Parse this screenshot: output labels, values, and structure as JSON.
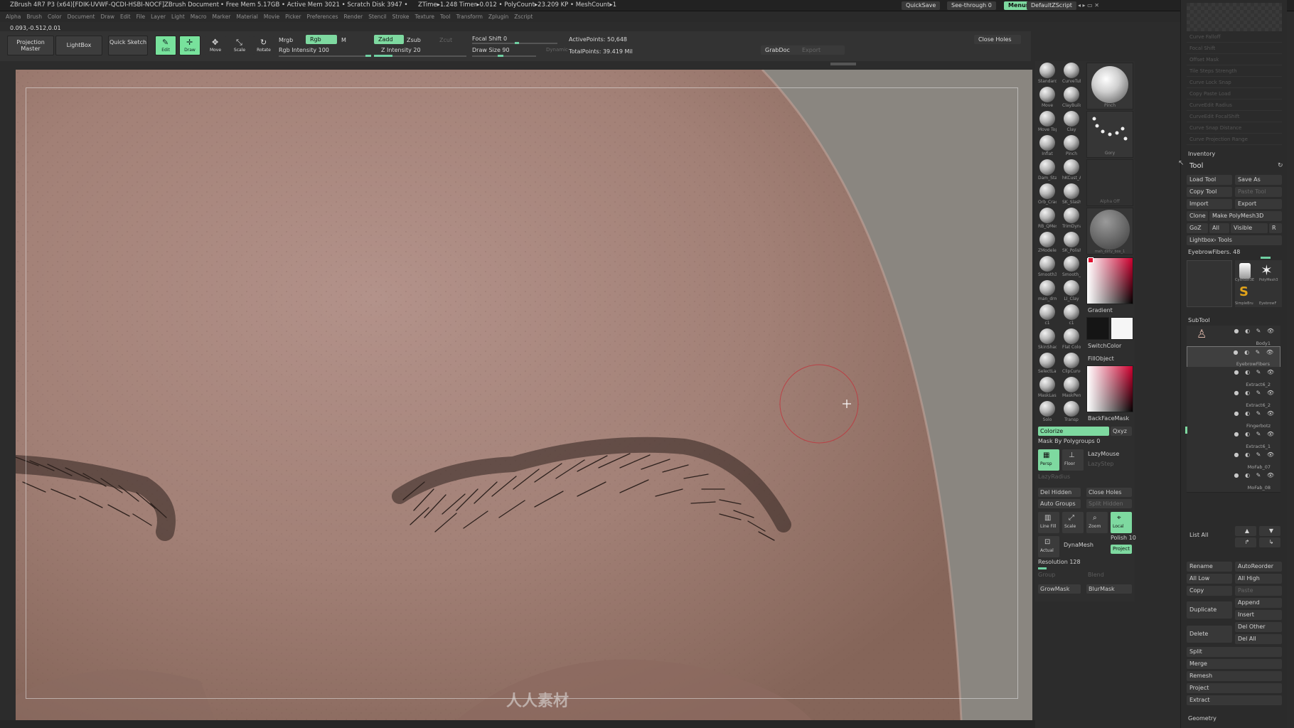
{
  "app": {
    "title": "ZBrush 4R7 P3 (x64)[FDIK-UVWF-QCDI-HSBI-NOCF]ZBrush Document",
    "mem": "• Free Mem 5.17GB • Active Mem 3021 • Scratch Disk 3947 •",
    "timer": "ZTime▸1.248 Timer▸0.012 • PolyCount▸23.209 KP • MeshCount▸1",
    "quicksave": "QuickSave",
    "see_through": "See-through   0",
    "menus": "Menus",
    "default_script": "DefaultZScript"
  },
  "menubar": [
    "Alpha",
    "Brush",
    "Color",
    "Document",
    "Draw",
    "Edit",
    "File",
    "Layer",
    "Light",
    "Macro",
    "Marker",
    "Material",
    "Movie",
    "Picker",
    "Preferences",
    "Render",
    "Stencil",
    "Stroke",
    "Texture",
    "Tool",
    "Transform",
    "Zplugin",
    "Zscript"
  ],
  "coords": "0.093,-0.512,0.01",
  "shelf": {
    "projection_master": "Projection Master",
    "lightbox": "LightBox",
    "quick_sketch": "Quick Sketch",
    "edit": "Edit",
    "draw": "Draw",
    "move": "Move",
    "scale": "Scale",
    "rotate": "Rotate",
    "mrgb": "Mrgb",
    "rgb": "Rgb",
    "m": "M",
    "zadd": "Zadd",
    "zsub": "Zsub",
    "zcut": "Zcut",
    "rgb_intensity": "Rgb Intensity 100",
    "z_intensity": "Z Intensity 20",
    "focal_shift": "Focal Shift 0",
    "draw_size": "Draw Size 90",
    "dynamic": "Dynamic",
    "active_points": "ActivePoints: 50,648",
    "total_points": "TotalPoints: 39.419 Mil",
    "grabdoc": "GrabDoc",
    "export": "Export",
    "close_holes": "Close Holes"
  },
  "brushes": [
    [
      "Standard",
      "CurveTube"
    ],
    [
      "Move",
      "ClayBuildup"
    ],
    [
      "Move Top",
      "Clay"
    ],
    [
      "Inflat",
      "Pinch"
    ],
    [
      "Dam_Stan",
      "hKCust_A"
    ],
    [
      "Orb_Crac",
      "SK_Slash"
    ],
    [
      "RB_QMes",
      "TrimDynar"
    ],
    [
      "ZModeler",
      "SK_Polish"
    ],
    [
      "Smooth35",
      "Smooth_S"
    ],
    [
      "man_drm",
      "LI_Clay"
    ],
    [
      "c1",
      "c1"
    ],
    [
      "SkinShade",
      "Flat Color"
    ],
    [
      "SelectLass",
      "ClipCurve"
    ],
    [
      "MaskLasso",
      "MaskPen"
    ],
    [
      "Solo",
      "Transp"
    ]
  ],
  "palette": {
    "pinch": "Pinch",
    "gory": "Gory",
    "alpha_off": "Alpha Off",
    "material": "mah_dirty_box_1",
    "gradient": "Gradient",
    "switch_color": "SwitchColor",
    "fill_object": "FillObject",
    "backface_mask": "BackFaceMask",
    "colorize": "Colorize",
    "xyz": "Qxyz",
    "mask_by_polygroups": "Mask By Polygroups 0",
    "lazymouse": "LazyMouse",
    "lazystep": "LazyStep",
    "lazyradius": "LazyRadius",
    "persp": "Persp",
    "floor": "Floor",
    "del_hidden": "Del Hidden",
    "close_holes": "Close Holes",
    "auto_groups": "Auto Groups",
    "split_hidden": "Split Hidden",
    "line_fill": "Line Fill",
    "scale": "Scale",
    "zoom": "Zoom",
    "local": "Local",
    "polish": "Polish 10",
    "actual": "Actual",
    "dynamesh": "DynaMesh",
    "project": "Project",
    "resolution": "Resolution 128",
    "group": "Group",
    "blend": "Blend",
    "growmask": "GrowMask",
    "blurmask": "BlurMask"
  },
  "toolpanel": {
    "inventory": "Inventory",
    "tool": "Tool",
    "load_tool": "Load Tool",
    "save_as": "Save As",
    "copy_tool": "Copy Tool",
    "paste_tool": "Paste Tool",
    "import": "Import",
    "export": "Export",
    "clone": "Clone",
    "make_polymesh": "Make PolyMesh3D",
    "goz": "GoZ",
    "all": "All",
    "visible": "Visible",
    "r": "R",
    "lightbox_tools": "Lightbox› Tools",
    "eyebrowfibers": "EyebrowFibers. 48",
    "thumbs": [
      "Cylinder3E",
      "PolyMesh3",
      "SimpleBru",
      "EyebrowF"
    ],
    "subtool": "SubTool",
    "subtools": [
      "Body1",
      "EyebrowFibers",
      "Extract6_2",
      "Extract6_2",
      "Fingerbotz",
      "Extract6_1",
      "MoFab_07",
      "MoFab_08"
    ],
    "list_all": "List All",
    "rename": "Rename",
    "autoreorder": "AutoReorder",
    "all_low": "All Low",
    "all_high": "All High",
    "copy": "Copy",
    "paste": "Paste",
    "duplicate": "Duplicate",
    "append": "Append",
    "insert": "Insert",
    "delete": "Delete",
    "del_other": "Del Other",
    "del_all": "Del All",
    "split": "Split",
    "merge": "Merge",
    "remesh": "Remesh",
    "project": "Project",
    "extract": "Extract",
    "geometry": "Geometry",
    "curve_rows": [
      "Curve Falloff",
      "Focal Shift",
      "Offset   Mask",
      "Tile   Steps   Strength",
      "Curve   Lock   Snap",
      "Copy  Paste  Load",
      "CurveEdit Radius",
      "CurveEdit FocalShift",
      "Curve Snap Distance",
      "Curve Projection Range"
    ]
  },
  "watermark": "人人素材",
  "colors": {
    "accent": "#7ed9a0",
    "skin": "#a38378",
    "panel": "#2b2b2b"
  }
}
